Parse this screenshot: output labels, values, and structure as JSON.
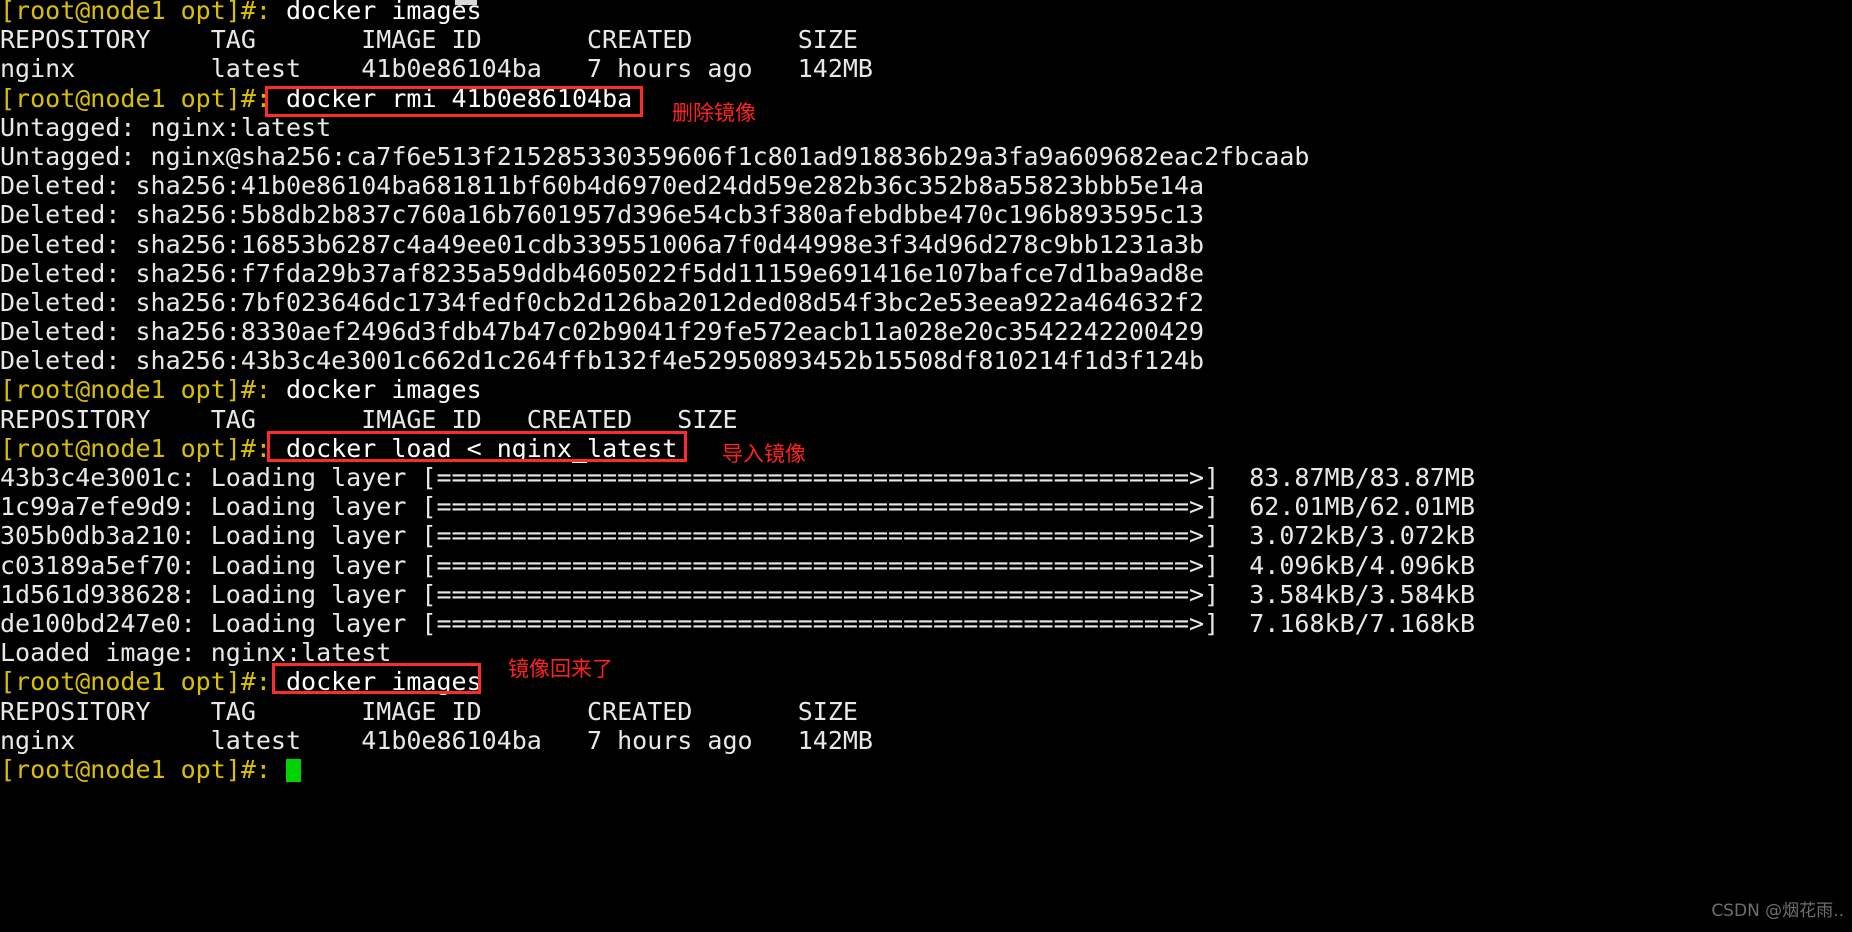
{
  "terminal": {
    "prompt": "[root@node1 opt]#:",
    "cursor": "block-cursor",
    "lines": [
      {
        "id": "l1",
        "type": "command",
        "prompt": "[root@node1 opt]#:",
        "text": " docker images"
      },
      {
        "id": "l2",
        "type": "output",
        "text": "REPOSITORY    TAG       IMAGE ID       CREATED       SIZE"
      },
      {
        "id": "l3",
        "type": "output",
        "text": "nginx         latest    41b0e86104ba   7 hours ago   142MB"
      },
      {
        "id": "l4",
        "type": "command",
        "prompt": "[root@node1 opt]#:",
        "text": " docker rmi 41b0e86104ba"
      },
      {
        "id": "l5",
        "type": "output",
        "text": "Untagged: nginx:latest"
      },
      {
        "id": "l6",
        "type": "output",
        "text": "Untagged: nginx@sha256:ca7f6e513f215285330359606f1c801ad918836b29a3fa9a609682eac2fbcaab"
      },
      {
        "id": "l7",
        "type": "output",
        "text": "Deleted: sha256:41b0e86104ba681811bf60b4d6970ed24dd59e282b36c352b8a55823bbb5e14a"
      },
      {
        "id": "l8",
        "type": "output",
        "text": "Deleted: sha256:5b8db2b837c760a16b7601957d396e54cb3f380afebdbbe470c196b893595c13"
      },
      {
        "id": "l9",
        "type": "output",
        "text": "Deleted: sha256:16853b6287c4a49ee01cdb339551006a7f0d44998e3f34d96d278c9bb1231a3b"
      },
      {
        "id": "l10",
        "type": "output",
        "text": "Deleted: sha256:f7fda29b37af8235a59ddb4605022f5dd11159e691416e107bafce7d1ba9ad8e"
      },
      {
        "id": "l11",
        "type": "output",
        "text": "Deleted: sha256:7bf023646dc1734fedf0cb2d126ba2012ded08d54f3bc2e53eea922a464632f2"
      },
      {
        "id": "l12",
        "type": "output",
        "text": "Deleted: sha256:8330aef2496d3fdb47b47c02b9041f29fe572eacb11a028e20c3542242200429"
      },
      {
        "id": "l13",
        "type": "output",
        "text": "Deleted: sha256:43b3c4e3001c662d1c264ffb132f4e52950893452b15508df810214f1d3f124b"
      },
      {
        "id": "l14",
        "type": "command",
        "prompt": "[root@node1 opt]#:",
        "text": " docker images"
      },
      {
        "id": "l15",
        "type": "output",
        "text": "REPOSITORY    TAG       IMAGE ID   CREATED   SIZE"
      },
      {
        "id": "l16",
        "type": "command",
        "prompt": "[root@node1 opt]#:",
        "text": " docker load < nginx_latest"
      },
      {
        "id": "l17",
        "type": "output",
        "text": "43b3c4e3001c: Loading layer [==================================================>]  83.87MB/83.87MB"
      },
      {
        "id": "l18",
        "type": "output",
        "text": "1c99a7efe9d9: Loading layer [==================================================>]  62.01MB/62.01MB"
      },
      {
        "id": "l19",
        "type": "output",
        "text": "305b0db3a210: Loading layer [==================================================>]  3.072kB/3.072kB"
      },
      {
        "id": "l20",
        "type": "output",
        "text": "c03189a5ef70: Loading layer [==================================================>]  4.096kB/4.096kB"
      },
      {
        "id": "l21",
        "type": "output",
        "text": "1d561d938628: Loading layer [==================================================>]  3.584kB/3.584kB"
      },
      {
        "id": "l22",
        "type": "output",
        "text": "de100bd247e0: Loading layer [==================================================>]  7.168kB/7.168kB"
      },
      {
        "id": "l23",
        "type": "output",
        "text": "Loaded image: nginx:latest"
      },
      {
        "id": "l24",
        "type": "command",
        "prompt": "[root@node1 opt]#:",
        "text": " docker images"
      },
      {
        "id": "l25",
        "type": "output",
        "text": "REPOSITORY    TAG       IMAGE ID       CREATED       SIZE"
      },
      {
        "id": "l26",
        "type": "output",
        "text": "nginx         latest    41b0e86104ba   7 hours ago   142MB"
      },
      {
        "id": "l27",
        "type": "prompt_only",
        "prompt": "[root@node1 opt]#:",
        "text": " "
      }
    ]
  },
  "annotations": [
    {
      "id": "a1",
      "label": "删除镜像",
      "box_color": "#ff2a2a",
      "text_color": "#ff2020"
    },
    {
      "id": "a2",
      "label": "导入镜像",
      "box_color": "#ff2a2a",
      "text_color": "#ff2020"
    },
    {
      "id": "a3",
      "label": "镜像回来了",
      "box_color": "#ff2a2a",
      "text_color": "#ff2020"
    }
  ],
  "watermark": {
    "text": "CSDN @烟花雨.."
  },
  "colors": {
    "background": "#000000",
    "prompt": "#d8c000",
    "output": "#e8e8e8",
    "cursor": "#00d400",
    "annotation": "#ff2a2a"
  }
}
